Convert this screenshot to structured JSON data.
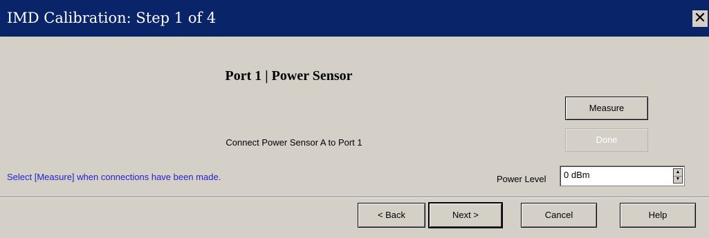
{
  "window": {
    "title": "IMD Calibration: Step 1 of 4",
    "close_glyph": "✕",
    "title_bar_color": "#0a246a"
  },
  "content": {
    "heading": "Port 1 | Power Sensor",
    "instruction": "Connect Power Sensor A to Port 1",
    "hint": "Select [Measure] when connections have been made.",
    "hint_color": "#2222cc"
  },
  "actions": {
    "measure_label": "Measure",
    "done_label": "Done",
    "done_enabled": false
  },
  "power": {
    "label": "Power Level",
    "value": "0 dBm",
    "spin_up_glyph": "▲",
    "spin_down_glyph": "▼"
  },
  "footer": {
    "back_label": "< Back",
    "next_label": "Next >",
    "cancel_label": "Cancel",
    "help_label": "Help"
  }
}
